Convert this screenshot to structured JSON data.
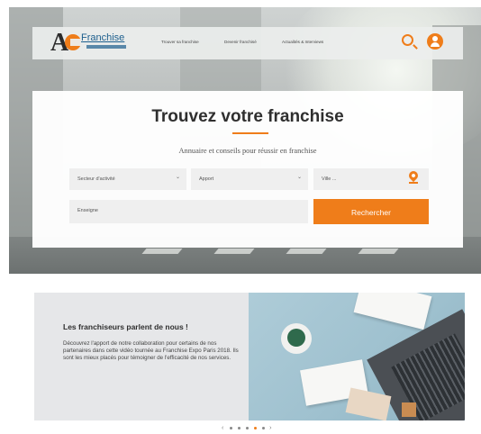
{
  "header": {
    "logo_text": "Franchise",
    "nav": [
      "Trouver sa franchise",
      "Devenir franchisé",
      "Actualités & Interviews"
    ],
    "search_icon": "search-icon",
    "user_icon": "user-icon"
  },
  "hero": {
    "title": "Trouvez votre franchise",
    "subtitle": "Annuaire et conseils pour réussir en franchise",
    "sector_select": "Secteur d'activité",
    "apport_select": "Apport",
    "ville_placeholder": "Ville ...",
    "enseigne_placeholder": "Enseigne",
    "search_button": "Rechercher"
  },
  "promo": {
    "title": "Les franchiseurs parlent de nous !",
    "text": "Découvrez l'apport de notre collaboration pour certains de nos partenaires dans cette vidéo tournée au Franchise Expo Paris 2018. Ils sont les mieux placés pour témoigner de l'efficacité de nos services."
  },
  "carousel": {
    "prev": "‹",
    "next": "›",
    "slide_count": 5,
    "active_index": 3
  },
  "colors": {
    "accent": "#ef7d1a",
    "logo_blue": "#1c5e8d"
  }
}
